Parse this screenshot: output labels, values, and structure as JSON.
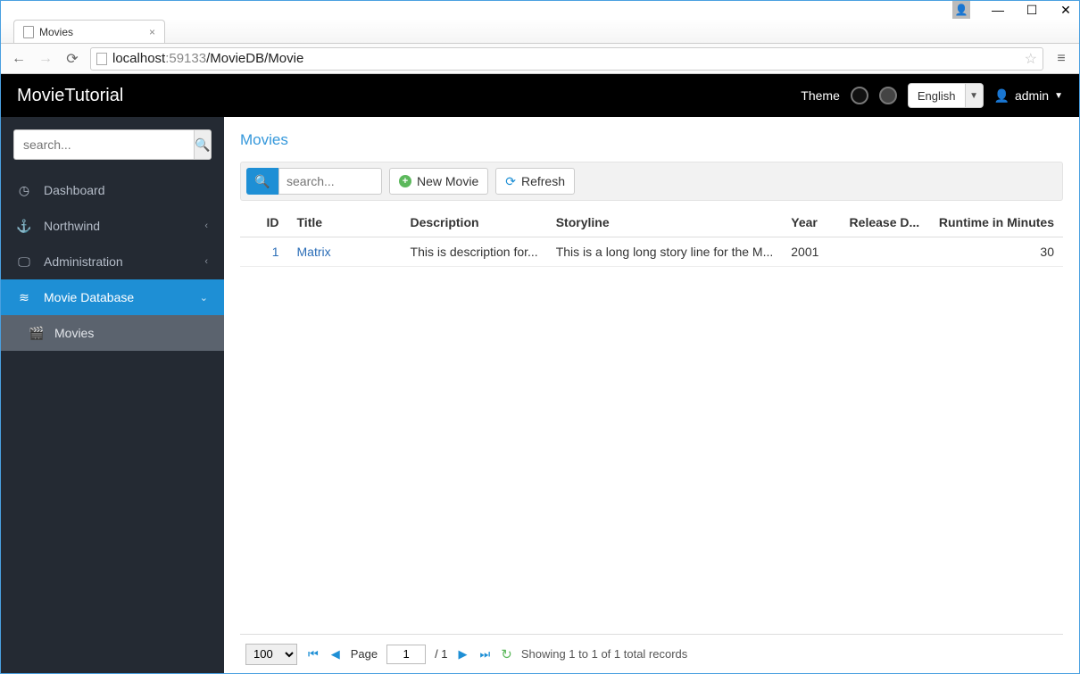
{
  "window": {
    "tab_title": "Movies"
  },
  "browser": {
    "url_host": "localhost",
    "url_port": ":59133",
    "url_path": "/MovieDB/Movie"
  },
  "header": {
    "brand": "MovieTutorial",
    "theme_label": "Theme",
    "language": "English",
    "username": "admin"
  },
  "sidebar": {
    "search_placeholder": "search...",
    "items": [
      {
        "label": "Dashboard"
      },
      {
        "label": "Northwind"
      },
      {
        "label": "Administration"
      },
      {
        "label": "Movie Database"
      }
    ],
    "sub": {
      "label": "Movies"
    }
  },
  "page": {
    "title": "Movies",
    "toolbar": {
      "search_placeholder": "search...",
      "new_label": "New Movie",
      "refresh_label": "Refresh"
    },
    "columns": {
      "id": "ID",
      "title": "Title",
      "description": "Description",
      "storyline": "Storyline",
      "year": "Year",
      "release_date": "Release D...",
      "runtime": "Runtime in Minutes"
    },
    "rows": [
      {
        "id": "1",
        "title": "Matrix",
        "description": "This is description for...",
        "storyline": "This is a long long story line for the M...",
        "year": "2001",
        "release_date": "",
        "runtime": "30"
      }
    ],
    "pager": {
      "page_size": "100",
      "page_label": "Page",
      "current_page": "1",
      "total_pages": "/ 1",
      "info": "Showing 1 to 1 of 1 total records"
    }
  }
}
